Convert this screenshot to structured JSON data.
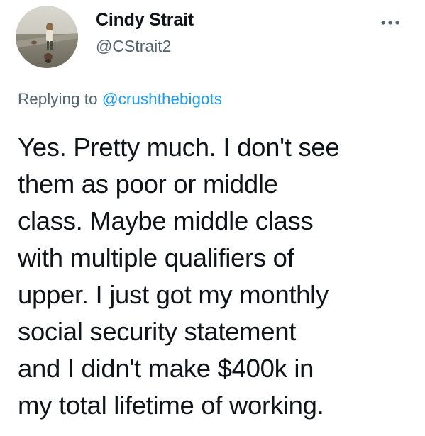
{
  "author": {
    "display_name": "Cindy Strait",
    "handle": "@CStrait2",
    "avatar_icon": "profile-photo-avatar"
  },
  "menu": {
    "more_icon": "more-options-icon"
  },
  "reply": {
    "prefix": "Replying to ",
    "mention": "@crushthebigots"
  },
  "tweet": {
    "lines": [
      "Yes. Pretty much. I don't see",
      "them as poor or middle",
      "class. Maybe middle class",
      "with multiple qualifiers of",
      "upper. I just got my monthly",
      "social security statement",
      "and I didn't make $400k in",
      "my total lifetime of working."
    ]
  },
  "colors": {
    "text": "#0f1419",
    "secondary": "#536471",
    "link": "#1d9bf0",
    "background": "#ffffff"
  }
}
